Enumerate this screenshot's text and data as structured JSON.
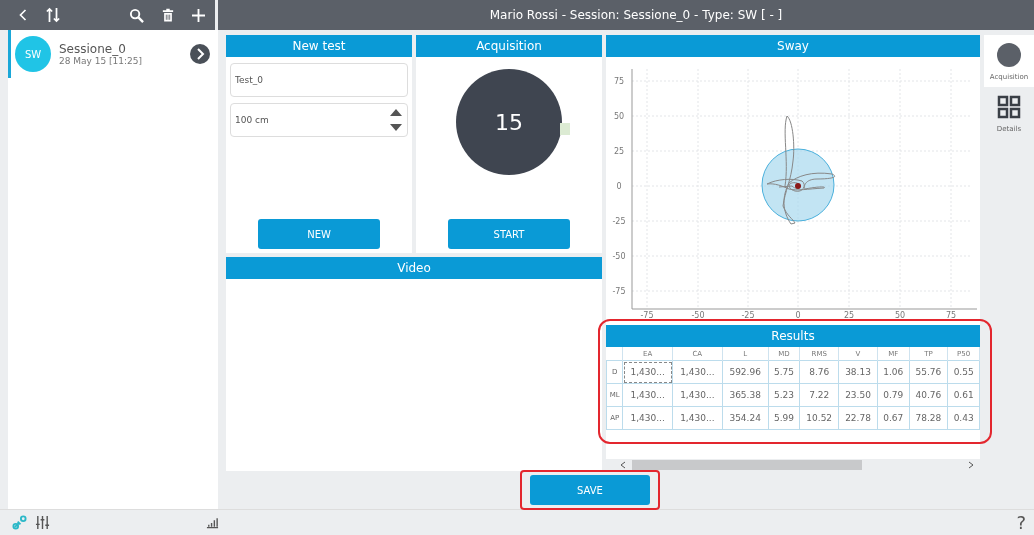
{
  "window": {
    "title": "Mario Rossi - Session: Sessione_0 - Type: SW [ - ]"
  },
  "sessions": [
    {
      "avatar": "SW",
      "name": "Sessione_0",
      "date": "28 May 15 [11:25]",
      "selected": true
    }
  ],
  "new_test": {
    "title": "New test",
    "name_value": "Test_0",
    "distance_value": "100 cm",
    "button": "NEW"
  },
  "acquisition": {
    "title": "Acquisition",
    "countdown": "15",
    "button": "START"
  },
  "video": {
    "title": "Video"
  },
  "sway": {
    "title": "Sway",
    "xticks": [
      "-75",
      "-50",
      "-25",
      "0",
      "25",
      "50",
      "75"
    ],
    "yticks": [
      "75",
      "50",
      "25",
      "0",
      "-25",
      "-50",
      "-75"
    ]
  },
  "results": {
    "title": "Results",
    "columns": [
      "",
      "EA",
      "CA",
      "L",
      "MD",
      "RMS",
      "V",
      "MF",
      "TP",
      "P50"
    ],
    "rows": [
      [
        "D",
        "1,430...",
        "1,430...",
        "592.96",
        "5.75",
        "8.76",
        "38.13",
        "1.06",
        "55.76",
        "0.55"
      ],
      [
        "ML",
        "1,430...",
        "1,430...",
        "365.38",
        "5.23",
        "7.22",
        "23.50",
        "0.79",
        "40.76",
        "0.61"
      ],
      [
        "AP",
        "1,430...",
        "1,430...",
        "354.24",
        "5.99",
        "10.52",
        "22.78",
        "0.67",
        "78.28",
        "0.43"
      ]
    ]
  },
  "save_button": "SAVE",
  "side_tabs": [
    {
      "kind": "acquisition",
      "label": "Acquisition",
      "selected": true
    },
    {
      "kind": "details",
      "label": "Details",
      "selected": false
    }
  ],
  "status_bar": {
    "help": "?"
  }
}
